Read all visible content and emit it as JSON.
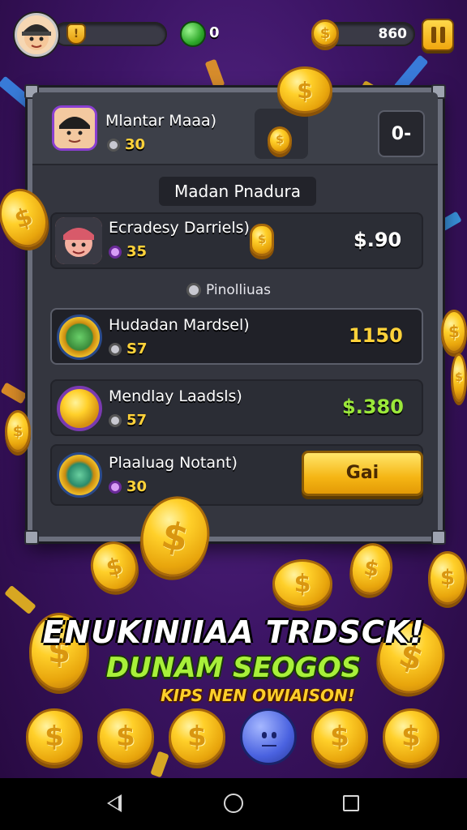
{
  "hud": {
    "gem_count": "0",
    "coin_count": "860"
  },
  "panel": {
    "player_name": "Mlantar Maaa)",
    "player_stat": "30",
    "value_box": "0-",
    "section_title": "Madan Pnadura",
    "featured": {
      "name": "Ecradesy Darriels)",
      "stat": "35",
      "price": "$.90"
    },
    "subheader": "Pinolliuas",
    "items": [
      {
        "name": "Hudadan Mardsel)",
        "stat": "S7",
        "price": "1150",
        "price_color": "#ffd23a"
      },
      {
        "name": "Mendlay Laadsls)",
        "stat": "57",
        "price": "$.380",
        "price_color": "#9be83a"
      },
      {
        "name": "Plaaluag Notant)",
        "stat": "30",
        "button": "Gai"
      }
    ]
  },
  "banner": {
    "line1": "ENUKINIIAA TRDSCK!",
    "line2": "DUNAM SEOGOS",
    "line3": "KIPS NEN OWIAISON!"
  },
  "coin_symbol": "$",
  "colors": {
    "gold": "#ffd23a",
    "green": "#9be83a",
    "panel": "#34363f",
    "accent_purple": "#8a3fd1"
  }
}
